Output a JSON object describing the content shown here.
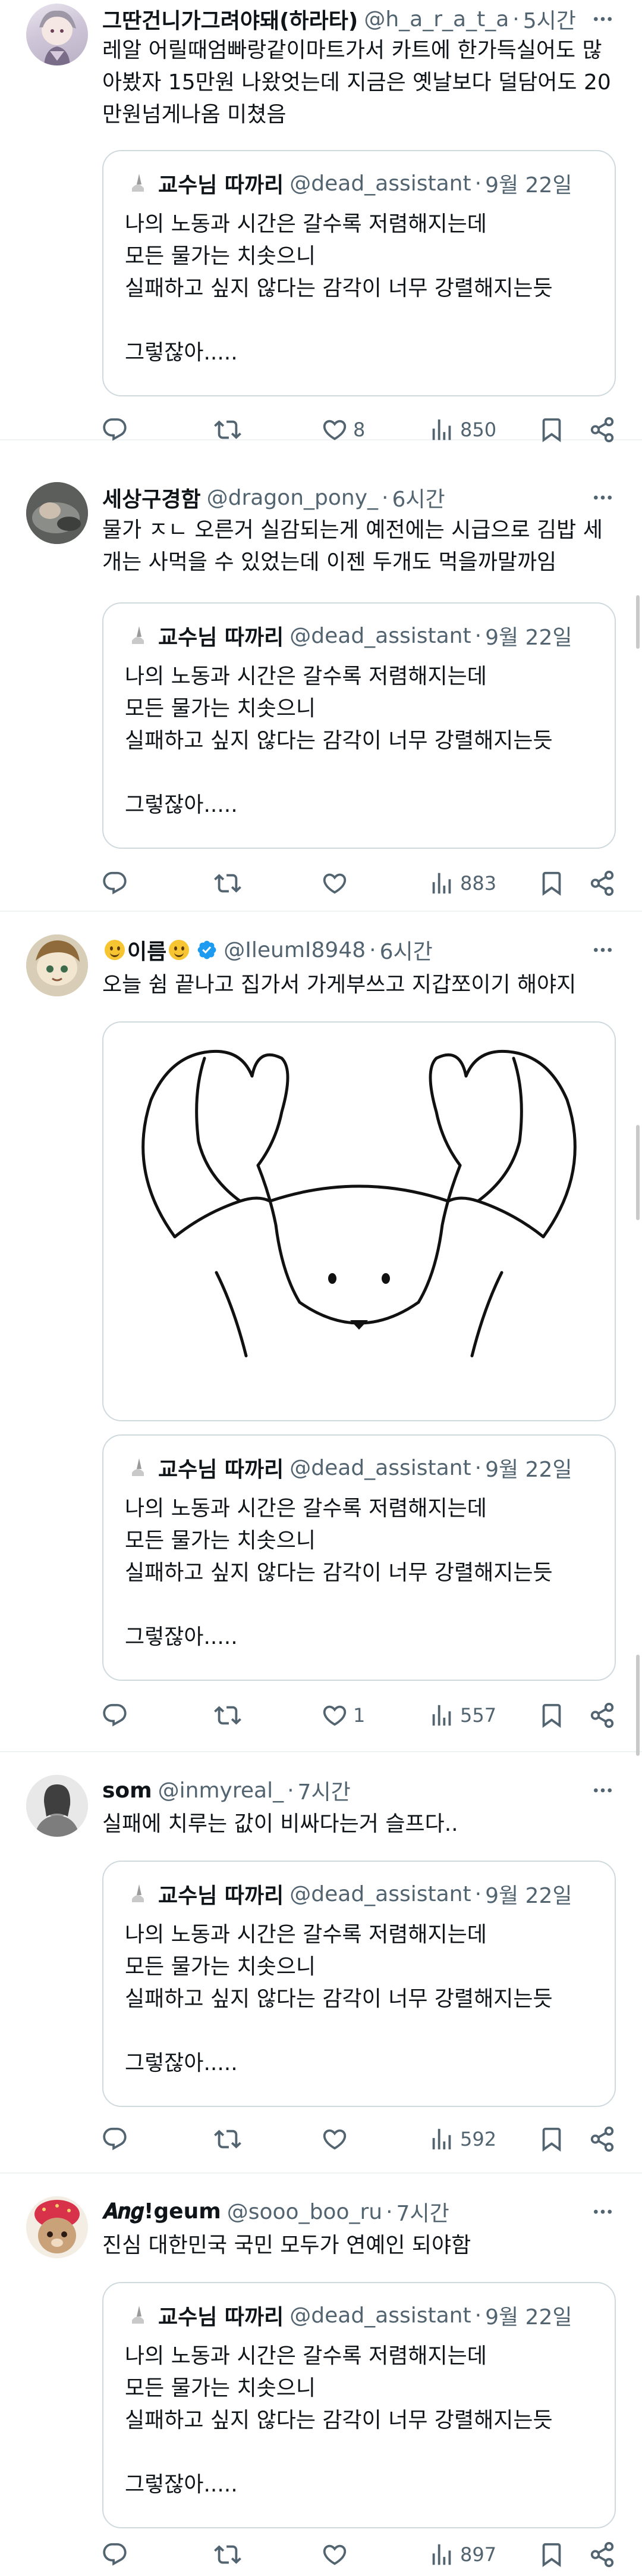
{
  "quoted_tweet": {
    "name": "교수님 따까리",
    "handle": "@dead_assistant",
    "time": "9월 22일",
    "text": "나의 노동과 시간은 갈수록 저렴해지는데\n모든 물가는 치솟으니\n실패하고 싶지 않다는 감각이 너무 강렬해지는듯\n\n그렇잖아....."
  },
  "tweets": [
    {
      "name": "그딴건니가그려야돼(하라타)",
      "handle": "@h_a_r_a_t_a",
      "time": "5시간",
      "text": "레알 어릴때엄빠랑같이마트가서 카트에 한가득실어도 많아봤자 15만원 나왔엇는데 지금은 옛날보다 덜담어도 20만원넘게나옴 미쳤음",
      "likes": "8",
      "views": "850"
    },
    {
      "name": "세상구경함",
      "handle": "@dragon_pony_",
      "time": "6시간",
      "text": "물가 ㅈㄴ 오른거 실감되는게 예전에는 시급으로 김밥 세개는 사먹을 수 있었는데 이젠 두개도 먹을까말까임",
      "likes": "",
      "views": "883"
    },
    {
      "name": "이름",
      "handle": "@IleumI8948",
      "time": "6시간",
      "text": "오늘 쉼 끝나고 집가서 가게부쓰고 지갑쪼이기 해야지",
      "likes": "1",
      "views": "557"
    },
    {
      "name": "som",
      "handle": "@inmyreal_",
      "time": "7시간",
      "text": "실패에 치루는 값이 비싸다는거 슬프다..",
      "likes": "",
      "views": "592"
    },
    {
      "name": "𝑨𝒏𝒈!geum",
      "handle": "@sooo_boo_ru",
      "time": "7시간",
      "text": "진심 대한민국 국민 모두가 연예인 되야함",
      "likes": "",
      "views": "897"
    }
  ],
  "colors": {
    "text": "#0f1419",
    "secondary": "#536471",
    "border": "#cfd9de",
    "divider": "#eff3f4",
    "verified": "#1d9bf0"
  },
  "icons": [
    "reply-icon",
    "retweet-icon",
    "like-icon",
    "views-icon",
    "bookmark-icon",
    "share-icon",
    "more-icon",
    "verified-icon"
  ]
}
